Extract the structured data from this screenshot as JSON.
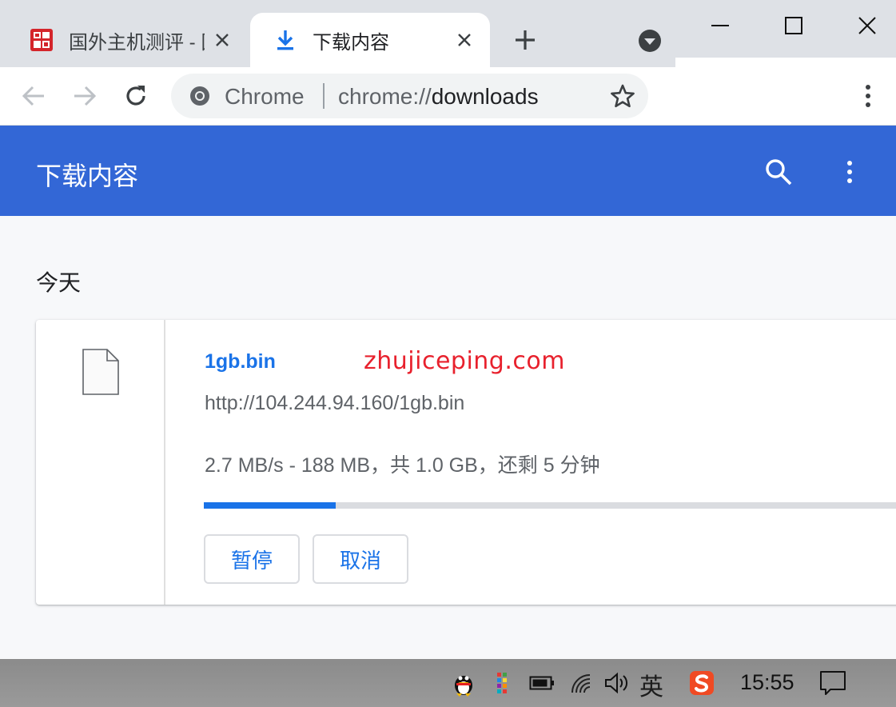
{
  "tabs": [
    {
      "title": "国外主机测评 - 国",
      "favicon": "seal-icon",
      "active": false
    },
    {
      "title": "下载内容",
      "favicon": "download-icon",
      "active": true
    }
  ],
  "omnibox": {
    "chip": "Chrome",
    "url_scheme": "chrome://",
    "url_host": "downloads"
  },
  "page": {
    "title": "下载内容",
    "date_group": "今天"
  },
  "download": {
    "filename": "1gb.bin",
    "watermark": "zhujiceping.com",
    "url": "http://104.244.94.160/1gb.bin",
    "status": "2.7 MB/s - 188 MB，共 1.0 GB，还剩 5 分钟",
    "progress_fraction": 0.188,
    "pause_label": "暂停",
    "cancel_label": "取消"
  },
  "taskbar": {
    "ime_lang": "英",
    "clock": "15:55",
    "tray_icons": [
      "qq-icon",
      "colorful-grid-icon",
      "battery-icon",
      "wifi-icon",
      "volume-icon",
      "sogou-icon",
      "notification-icon"
    ]
  },
  "colors": {
    "header_blue": "#3367d6",
    "link_blue": "#1a73e8",
    "watermark_red": "#e8212d"
  }
}
